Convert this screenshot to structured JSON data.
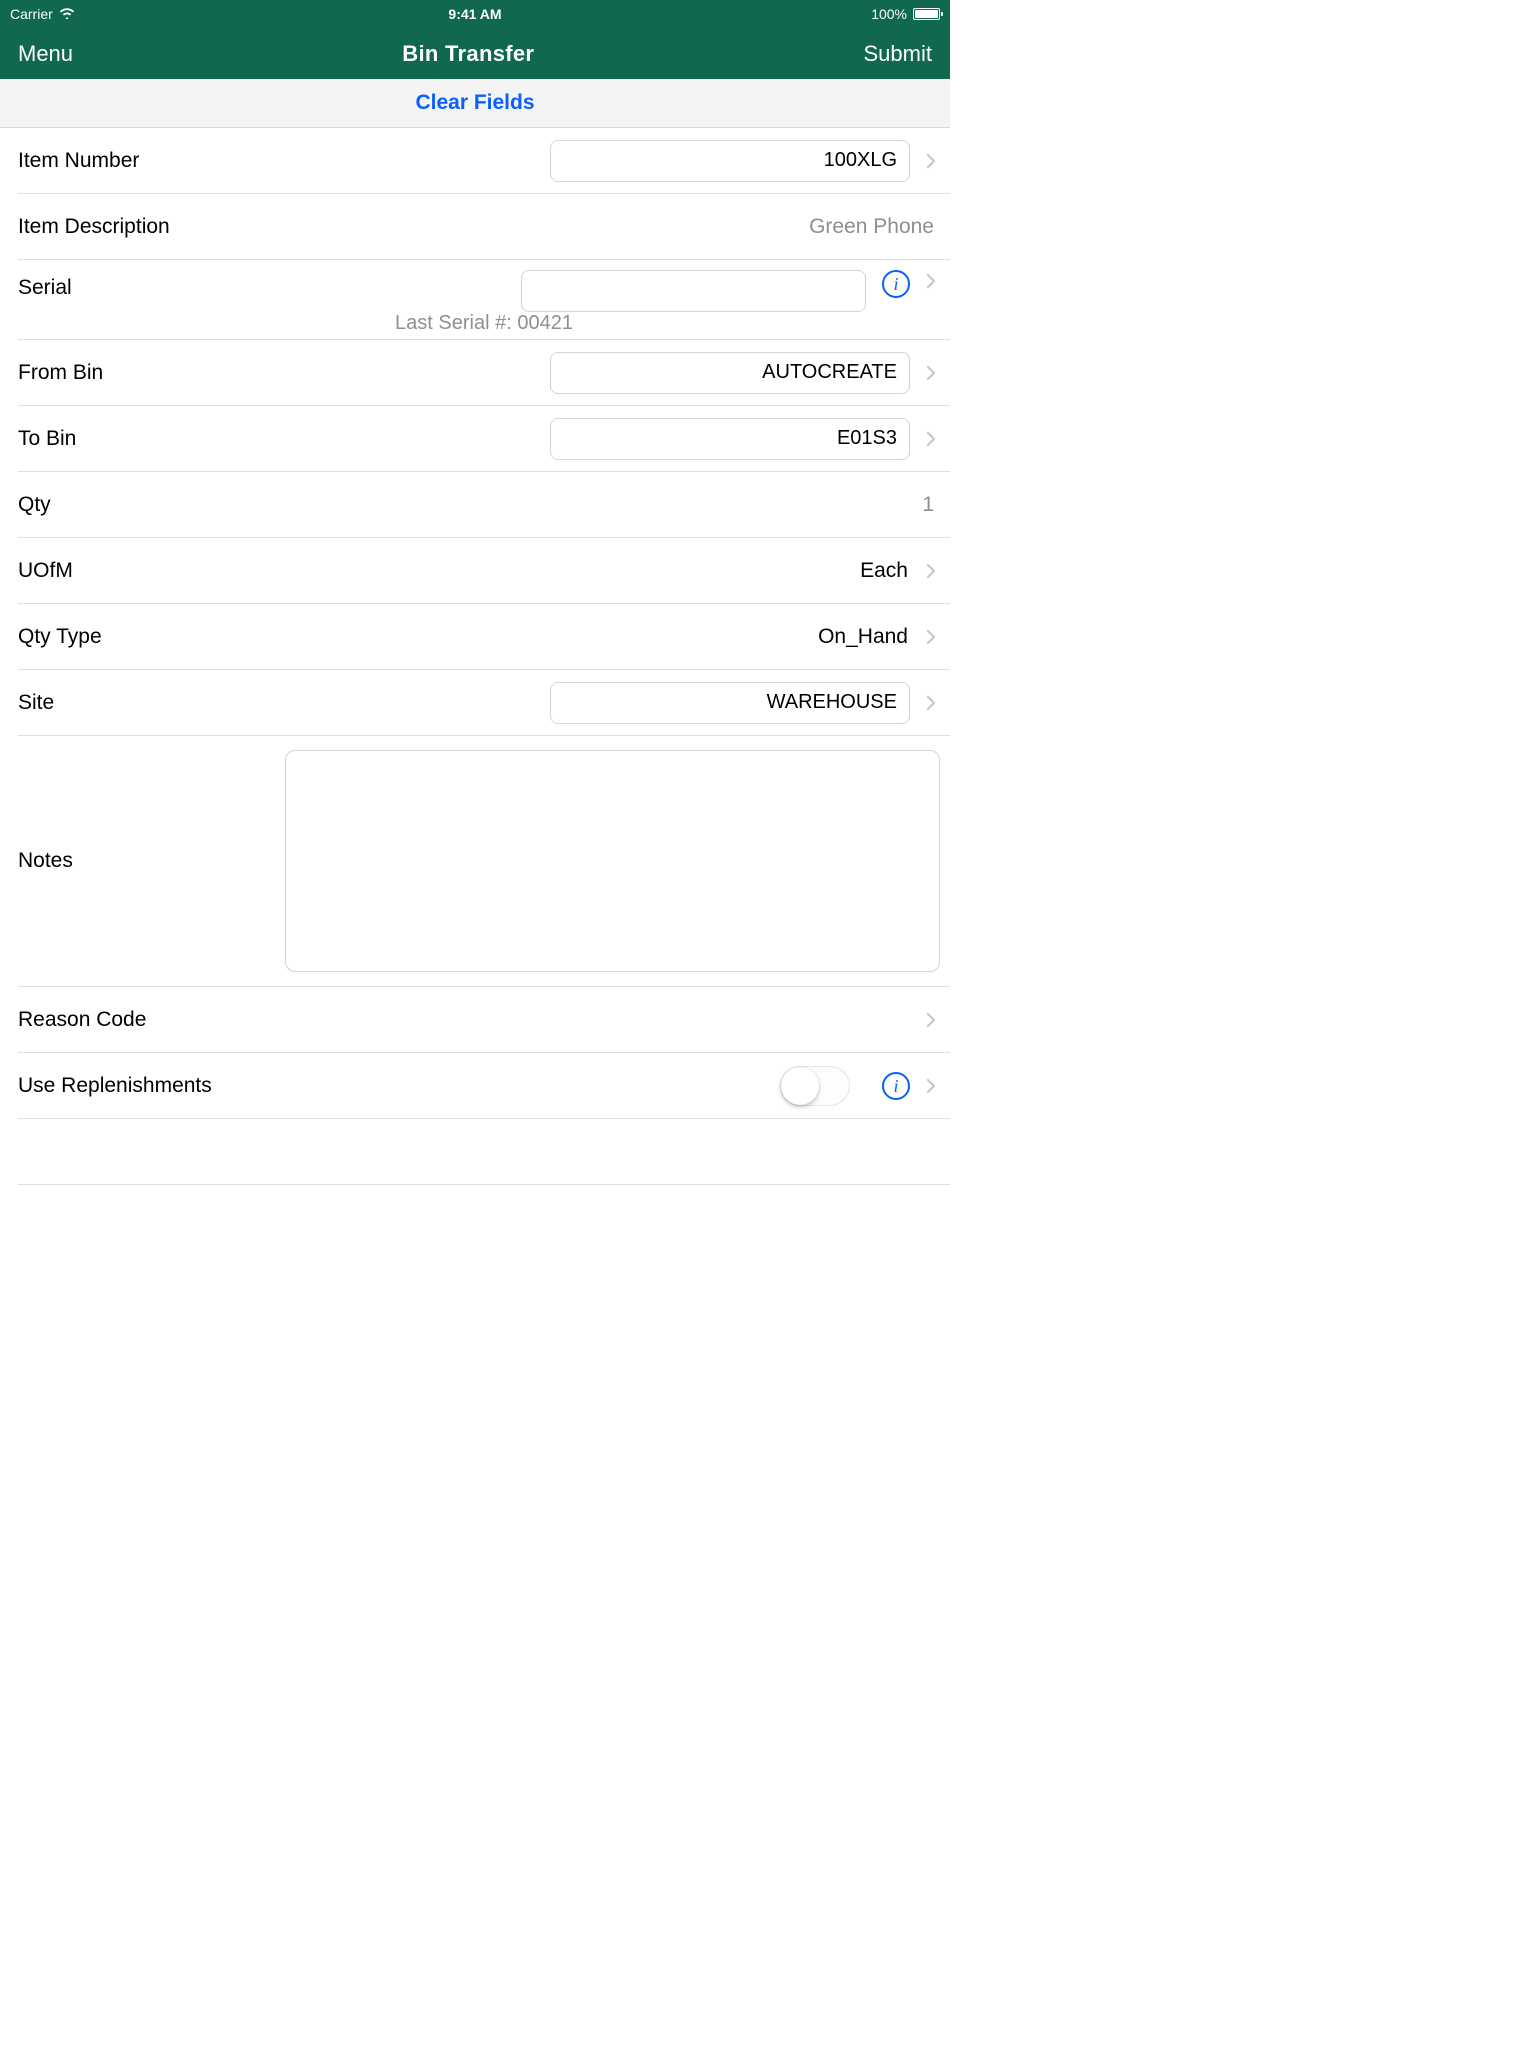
{
  "status": {
    "carrier": "Carrier",
    "time": "9:41 AM",
    "battery_pct": "100%"
  },
  "nav": {
    "left": "Menu",
    "title": "Bin Transfer",
    "right": "Submit"
  },
  "toolbar": {
    "clear_label": "Clear Fields"
  },
  "fields": {
    "item_number": {
      "label": "Item Number",
      "value": "100XLG"
    },
    "item_description": {
      "label": "Item Description",
      "value": "Green Phone"
    },
    "serial": {
      "label": "Serial",
      "value": "",
      "hint": "Last Serial #: 00421"
    },
    "from_bin": {
      "label": "From Bin",
      "value": "AUTOCREATE"
    },
    "to_bin": {
      "label": "To Bin",
      "value": "E01S3"
    },
    "qty": {
      "label": "Qty",
      "value": "1"
    },
    "uofm": {
      "label": "UOfM",
      "value": "Each"
    },
    "qty_type": {
      "label": "Qty Type",
      "value": "On_Hand"
    },
    "site": {
      "label": "Site",
      "value": "WAREHOUSE"
    },
    "notes": {
      "label": "Notes",
      "value": ""
    },
    "reason_code": {
      "label": "Reason Code",
      "value": ""
    },
    "use_replenishments": {
      "label": "Use Replenishments"
    }
  }
}
